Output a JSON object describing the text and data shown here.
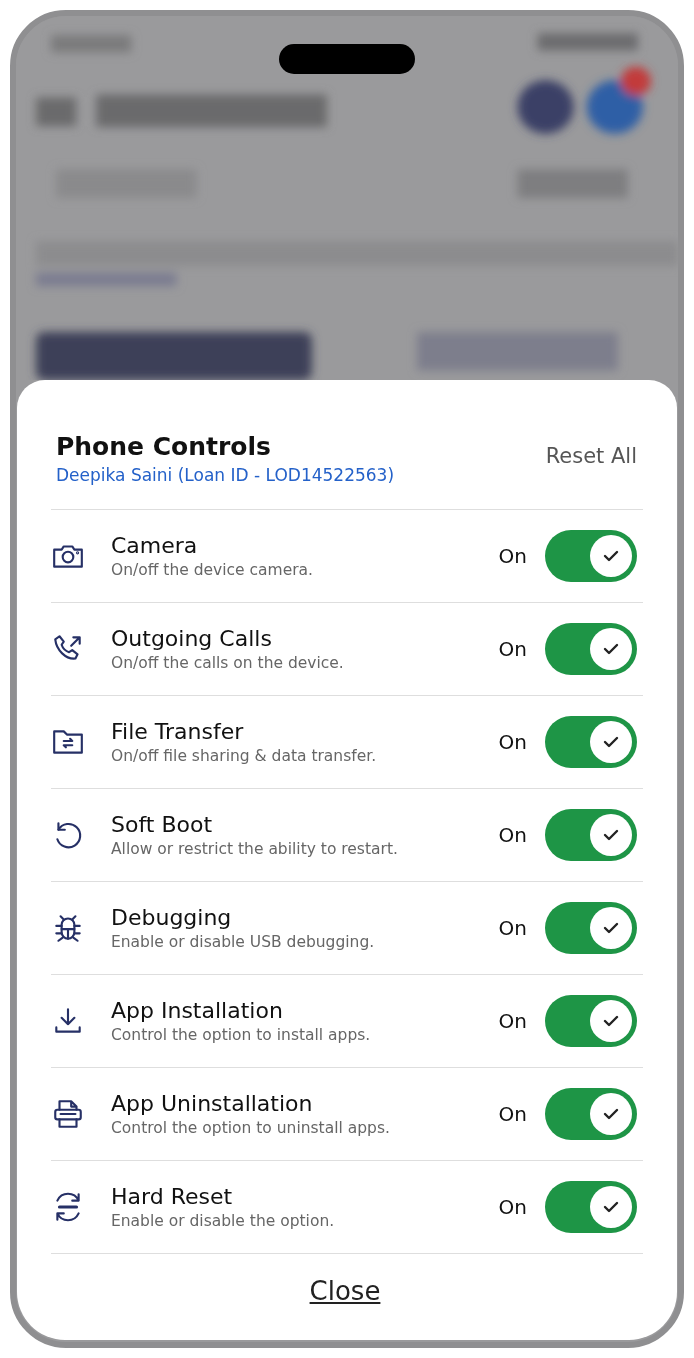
{
  "sheet": {
    "title": "Phone Controls",
    "subtitle": "Deepika Saini (Loan ID - LOD14522563)",
    "reset_button": "Reset All"
  },
  "controls": [
    {
      "kind": "camera",
      "title": "Camera",
      "description": "On/off the device camera.",
      "state_label": "On",
      "on": true
    },
    {
      "kind": "calls",
      "title": "Outgoing Calls",
      "description": "On/off the calls on the device.",
      "state_label": "On",
      "on": true
    },
    {
      "kind": "transfer",
      "title": "File Transfer",
      "description": "On/off file sharing & data transfer.",
      "state_label": "On",
      "on": true
    },
    {
      "kind": "reboot",
      "title": "Soft Boot",
      "description": "Allow or restrict the ability to restart.",
      "state_label": "On",
      "on": true
    },
    {
      "kind": "debug",
      "title": "Debugging",
      "description": "Enable or disable USB debugging.",
      "state_label": "On",
      "on": true
    },
    {
      "kind": "install",
      "title": "App Installation",
      "description": "Control the option to install apps.",
      "state_label": "On",
      "on": true
    },
    {
      "kind": "uninstall",
      "title": "App Uninstallation",
      "description": "Control the option to uninstall apps.",
      "state_label": "On",
      "on": true
    },
    {
      "kind": "reset",
      "title": "Hard Reset",
      "description": "Enable or disable the option.",
      "state_label": "On",
      "on": true
    }
  ],
  "close_button": "Close"
}
